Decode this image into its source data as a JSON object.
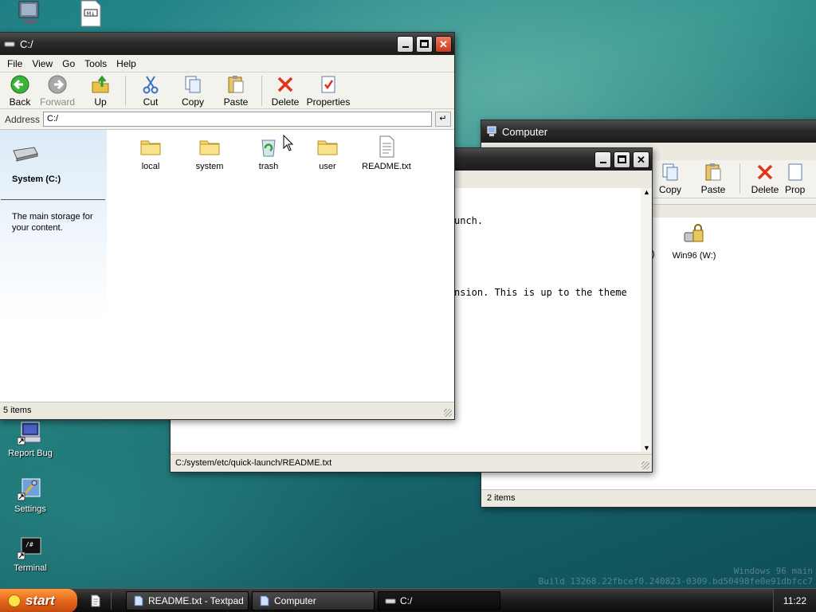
{
  "desktop": {
    "icons": [
      {
        "label": "Report Bug",
        "icon": "report-bug-icon"
      },
      {
        "label": "Settings",
        "icon": "settings-icon"
      },
      {
        "label": "Terminal",
        "icon": "terminal-icon"
      }
    ],
    "watermark": {
      "line1": "Windows 96 main",
      "line2": "Build 13268.22fbcef0.240823-0309.bd50498fe0e91dbfcc7"
    }
  },
  "explorer_main": {
    "title": "C:/",
    "menu": [
      "File",
      "View",
      "Go",
      "Tools",
      "Help"
    ],
    "toolbar": {
      "back": "Back",
      "forward": "Forward",
      "up": "Up",
      "cut": "Cut",
      "copy": "Copy",
      "paste": "Paste",
      "delete": "Delete",
      "properties": "Properties"
    },
    "address_label": "Address",
    "address_value": "C:/",
    "sidebar": {
      "drive_title": "System (C:)",
      "description": "The main storage for your content."
    },
    "files": [
      {
        "name": "local",
        "icon": "folder-icon"
      },
      {
        "name": "system",
        "icon": "folder-icon"
      },
      {
        "name": "trash",
        "icon": "recycle-bin-icon"
      },
      {
        "name": "user",
        "icon": "folder-icon"
      },
      {
        "name": "README.txt",
        "icon": "text-file-icon"
      }
    ],
    "status": "5 items"
  },
  "textpad": {
    "lines": [
      "unch.",
      "",
      "nsion. This is up to the theme"
    ],
    "status": "C:/system/etc/quick-launch/README.txt"
  },
  "computer": {
    "title": "Computer",
    "toolbar": {
      "copy": "Copy",
      "paste": "Paste",
      "delete": "Delete",
      "properties_partial": "Prop"
    },
    "drive_partial": ")",
    "drive": "Win96 (W:)",
    "status": "2 items"
  },
  "taskbar": {
    "start_label": "start",
    "tasks": [
      {
        "label": "README.txt - Textpad",
        "icon": "textpad-icon"
      },
      {
        "label": "Computer",
        "icon": "computer-icon"
      },
      {
        "label": "C:/",
        "icon": "drive-icon"
      }
    ],
    "clock": "11:22"
  }
}
